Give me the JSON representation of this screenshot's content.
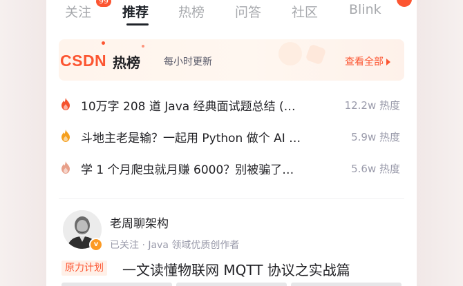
{
  "tabs": {
    "items": [
      {
        "label": "关注"
      },
      {
        "label": "推荐"
      },
      {
        "label": "热榜"
      },
      {
        "label": "问答"
      },
      {
        "label": "社区"
      },
      {
        "label": "Blink"
      }
    ],
    "follow_badge": "99",
    "active": "推荐"
  },
  "hot": {
    "logo": "CSDN",
    "title": "热榜",
    "subtitle": "每小时更新",
    "view_all": "查看全部",
    "items": [
      {
        "title": "10万字 208 道 Java 经典面试题总结 (…",
        "heat": "12.2w 热度",
        "flame_color": "#f5522d"
      },
      {
        "title": "斗地主老是输？一起用 Python 做个 AI …",
        "heat": "5.9w 热度",
        "flame_color": "#f59f1d"
      },
      {
        "title": "学 1 个月爬虫就月赚 6000？别被骗了…",
        "heat": "5.6w 热度",
        "flame_color": "#e8a08a"
      }
    ]
  },
  "article": {
    "author": "老周聊架构",
    "meta": "已关注 · Java 领域优质创作者",
    "tag": "原力计划",
    "title": "一文读懂物联网 MQTT 协议之实战篇",
    "verified_icon": "v"
  },
  "colors": {
    "accent": "#fc5531",
    "text": "#222226",
    "muted": "#999aaa"
  }
}
